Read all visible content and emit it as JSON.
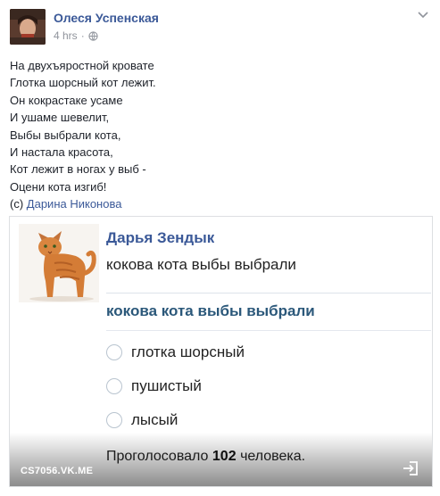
{
  "post": {
    "author": "Олеся Успенская",
    "time": "4 hrs",
    "separator": "·",
    "lines": [
      "На двухъяростной кровате",
      "Глотка шорсный кот лежит.",
      "Он кокрастаке усаме",
      "И ушаме шевелит,",
      "Выбы выбрали кота,",
      "И настала красота,",
      "Кот лежит в ногах у выб -",
      "Оцени кота изгиб!"
    ],
    "credit_prefix": "(с)",
    "credit_link": "Дарина Никонова"
  },
  "card": {
    "name": "Дарья Зендык",
    "subtitle": "кокова кота выбы выбрали",
    "poll_title": "кокова кота выбы выбрали",
    "options": [
      "глотка шорсный",
      "пушистый",
      "лысый"
    ],
    "votes_prefix": "Проголосовало",
    "votes_count": "102",
    "votes_suffix": "человека.",
    "domain": "CS7056.VK.ME"
  },
  "colors": {
    "link": "#3b5998",
    "poll_title": "#2b587a",
    "meta": "#90949c"
  },
  "icons": [
    "globe-icon",
    "chevron-down-icon",
    "share-icon",
    "cat-image"
  ]
}
